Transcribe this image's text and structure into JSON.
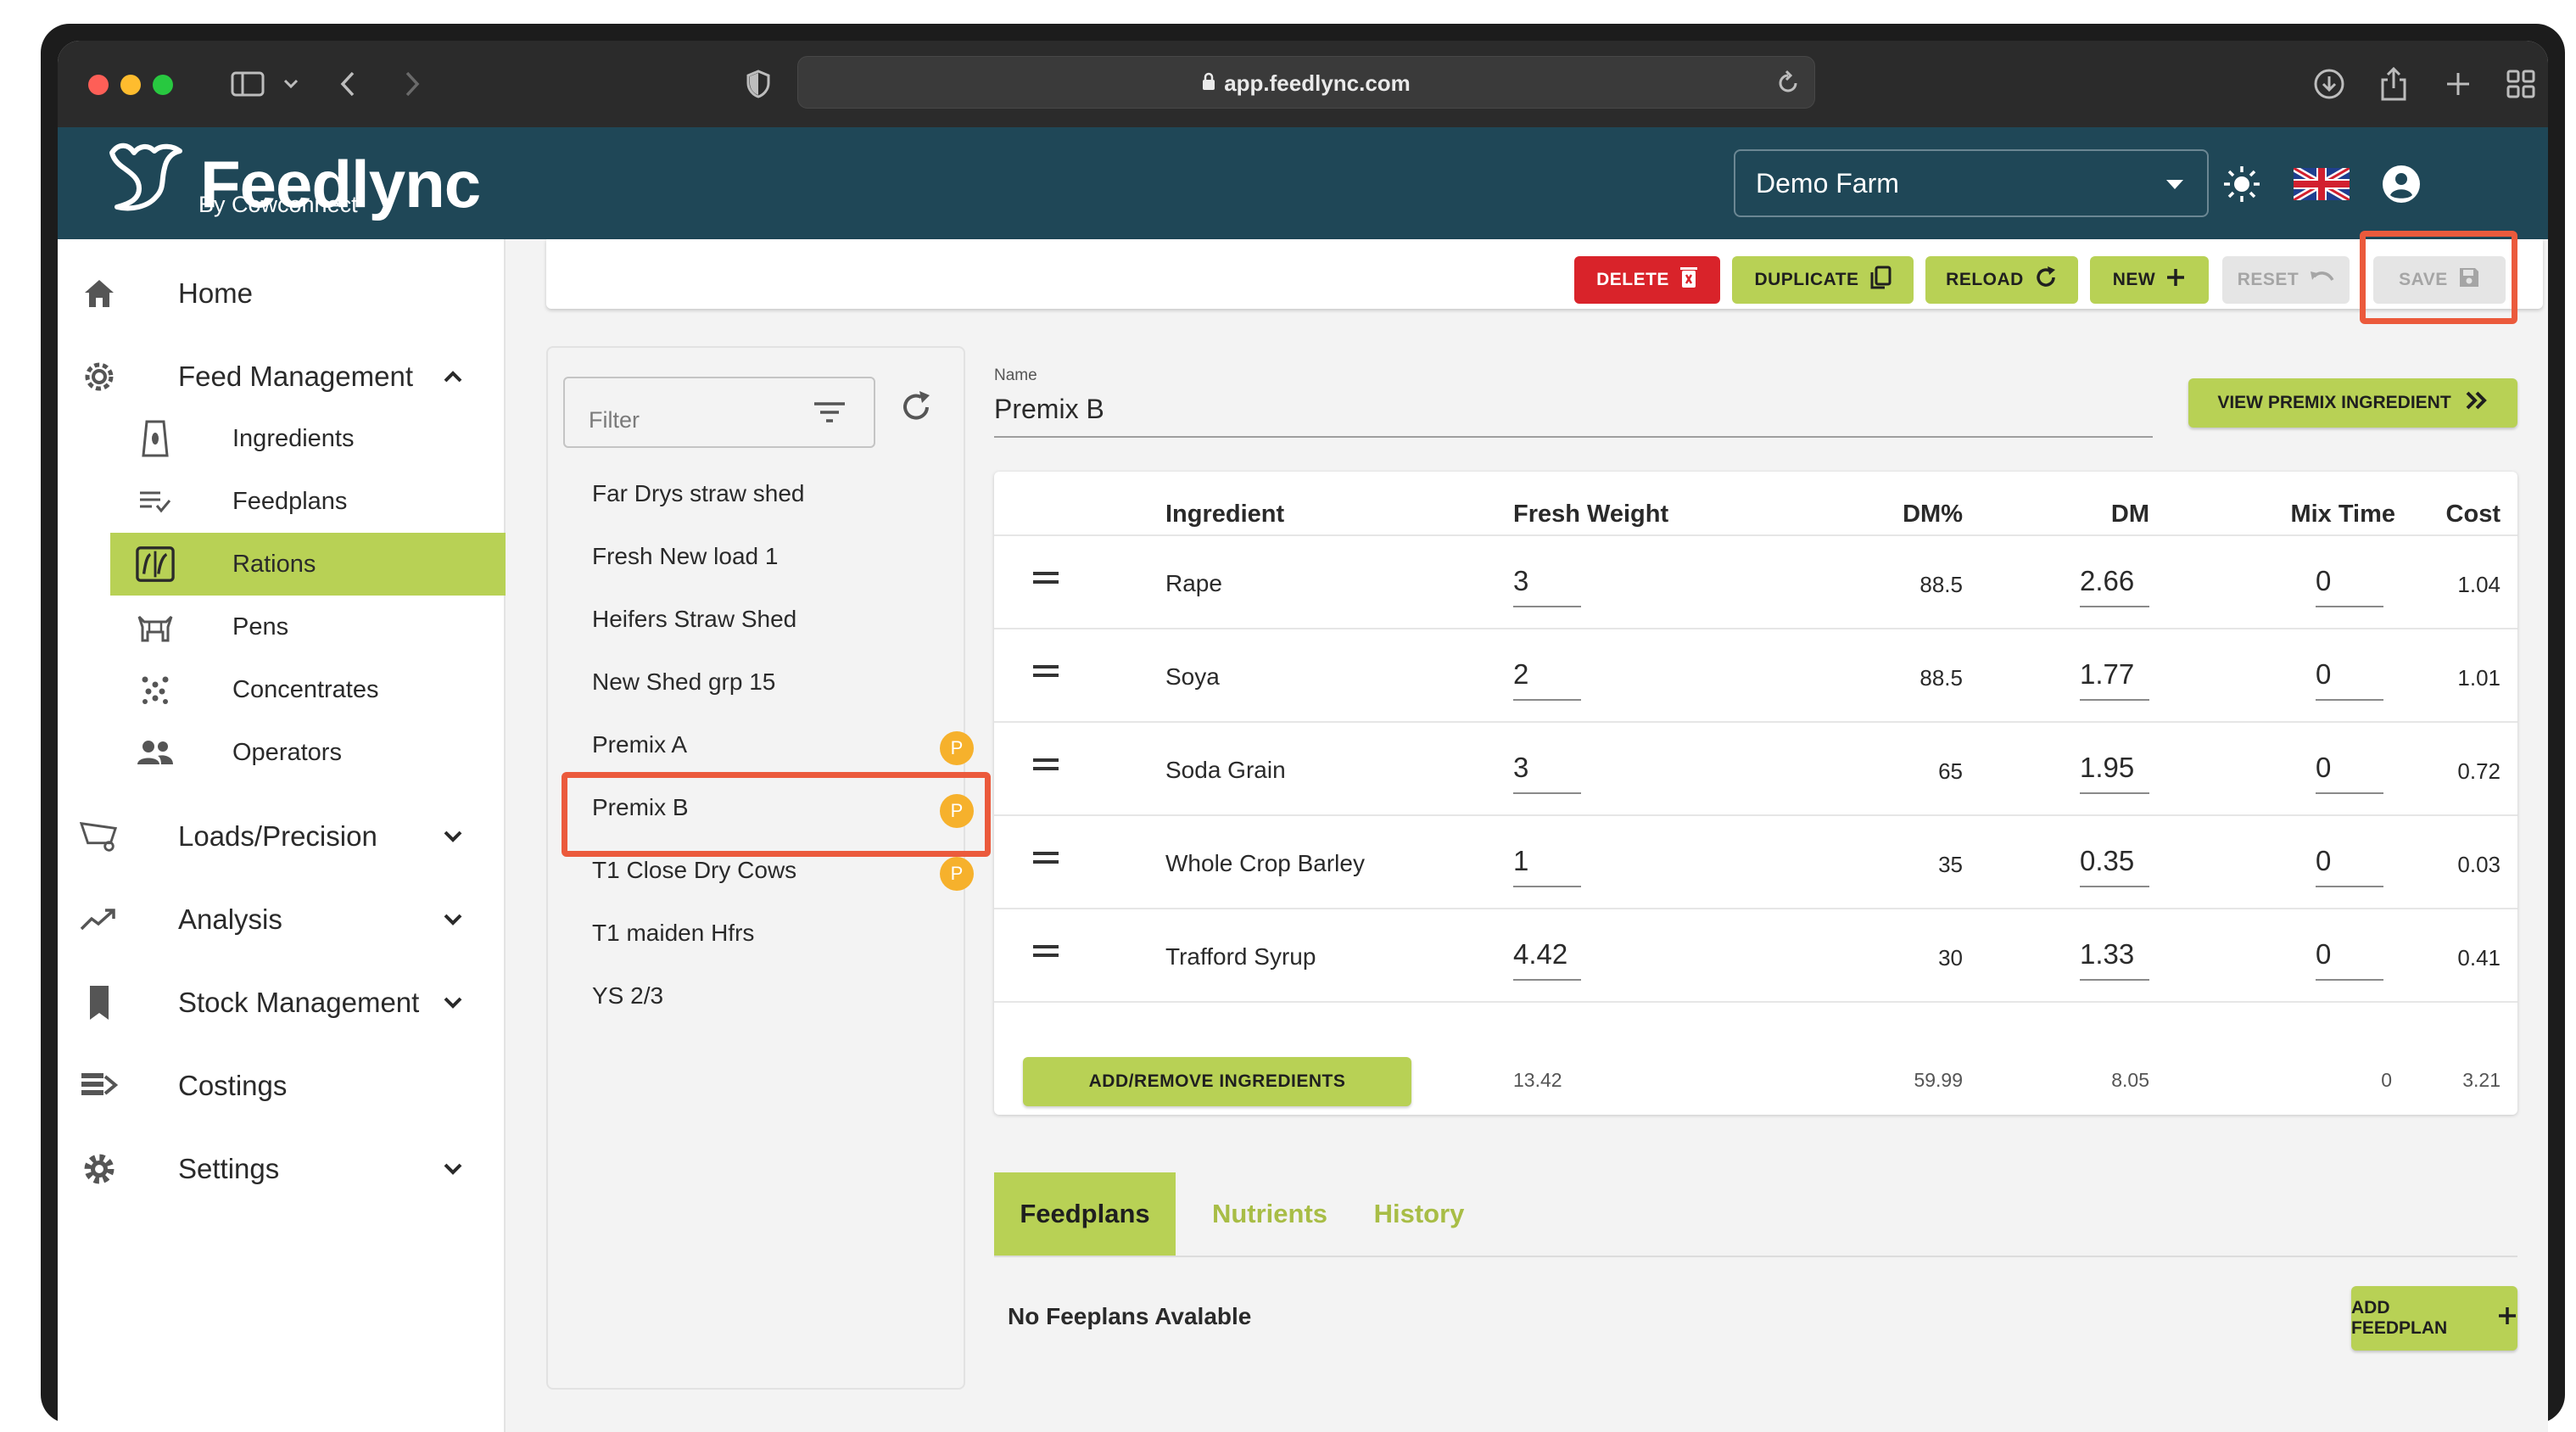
{
  "browser": {
    "url": "app.feedlync.com"
  },
  "brand": {
    "name": "Feedlync",
    "sub": "By Cowconnect",
    "header_color": "#1f4757",
    "accent_color": "#b8d155"
  },
  "header": {
    "farm": "Demo Farm",
    "icons": [
      "brightness-icon",
      "uk-flag-icon",
      "account-icon"
    ]
  },
  "sidebar": {
    "items": [
      {
        "label": "Home",
        "icon": "home-icon"
      },
      {
        "label": "Feed Management",
        "icon": "feed-gear-icon",
        "expanded": true
      },
      {
        "label": "Loads/Precision",
        "icon": "loader-truck-icon"
      },
      {
        "label": "Analysis",
        "icon": "trending-icon"
      },
      {
        "label": "Stock Management",
        "icon": "bookmark-icon"
      },
      {
        "label": "Costings",
        "icon": "costings-icon"
      },
      {
        "label": "Settings",
        "icon": "cog-icon"
      }
    ],
    "sub_items": [
      {
        "label": "Ingredients",
        "icon": "sack-icon"
      },
      {
        "label": "Feedplans",
        "icon": "list-check-icon"
      },
      {
        "label": "Rations",
        "icon": "rations-icon",
        "active": true
      },
      {
        "label": "Pens",
        "icon": "cow-icon"
      },
      {
        "label": "Concentrates",
        "icon": "dots-icon"
      },
      {
        "label": "Operators",
        "icon": "people-icon"
      }
    ]
  },
  "actions": {
    "delete": "DELETE",
    "duplicate": "DUPLICATE",
    "reload": "RELOAD",
    "new": "NEW",
    "reset": "RESET",
    "save": "SAVE"
  },
  "rations": {
    "filter_placeholder": "Filter",
    "items": [
      {
        "label": "Far Drys straw shed",
        "badge": ""
      },
      {
        "label": "Fresh New load 1",
        "badge": ""
      },
      {
        "label": "Heifers Straw Shed",
        "badge": ""
      },
      {
        "label": "New Shed grp 15",
        "badge": ""
      },
      {
        "label": "Premix A",
        "badge": "P"
      },
      {
        "label": "Premix B",
        "badge": "P",
        "selected": true
      },
      {
        "label": "T1 Close Dry Cows",
        "badge": "P"
      },
      {
        "label": "T1 maiden Hfrs",
        "badge": ""
      },
      {
        "label": "YS 2/3",
        "badge": ""
      }
    ]
  },
  "detail": {
    "name_label": "Name",
    "name": "Premix B",
    "view_premix": "VIEW PREMIX INGREDIENT",
    "table": {
      "headers": {
        "ingredient": "Ingredient",
        "fresh_weight": "Fresh Weight",
        "dm_pct": "DM%",
        "dm": "DM",
        "mix_time": "Mix Time",
        "cost": "Cost"
      },
      "rows": [
        {
          "ingredient": "Rape",
          "fresh_weight": "3",
          "dm_pct": "88.5",
          "dm": "2.66",
          "mix_time": "0",
          "cost": "1.04"
        },
        {
          "ingredient": "Soya",
          "fresh_weight": "2",
          "dm_pct": "88.5",
          "dm": "1.77",
          "mix_time": "0",
          "cost": "1.01"
        },
        {
          "ingredient": "Soda Grain",
          "fresh_weight": "3",
          "dm_pct": "65",
          "dm": "1.95",
          "mix_time": "0",
          "cost": "0.72"
        },
        {
          "ingredient": "Whole Crop Barley",
          "fresh_weight": "1",
          "dm_pct": "35",
          "dm": "0.35",
          "mix_time": "0",
          "cost": "0.03"
        },
        {
          "ingredient": "Trafford Syrup",
          "fresh_weight": "4.42",
          "dm_pct": "30",
          "dm": "1.33",
          "mix_time": "0",
          "cost": "0.41"
        }
      ],
      "add_remove": "ADD/REMOVE INGREDIENTS",
      "totals": {
        "fresh_weight": "13.42",
        "dm_pct": "59.99",
        "dm": "8.05",
        "mix_time": "0",
        "cost": "3.21"
      }
    },
    "tabs": [
      "Feedplans",
      "Nutrients",
      "History"
    ],
    "no_feedplans": "No Feeplans Avalable",
    "add_feedplan": "ADD FEEDPLAN"
  }
}
